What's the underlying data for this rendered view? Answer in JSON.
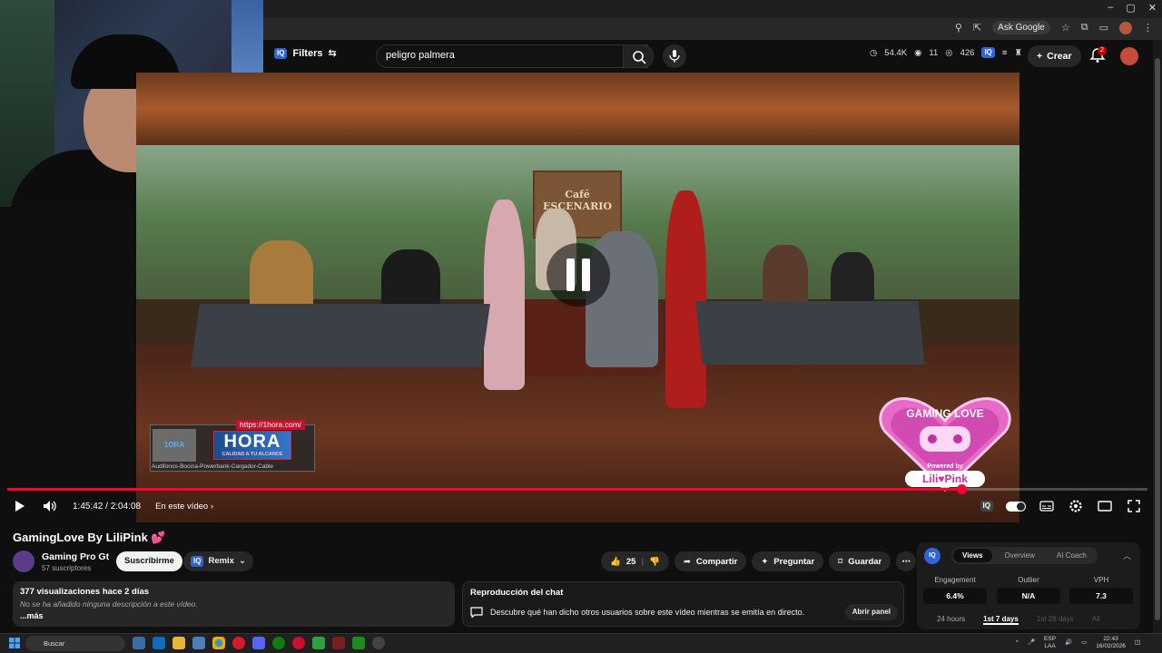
{
  "browser": {
    "ask_google": "Ask Google",
    "window_controls": [
      "–",
      "▢",
      "✕"
    ]
  },
  "header": {
    "filters_label": "Filters",
    "iq_badge": "IQ",
    "search": {
      "value": "peligro palmera",
      "placeholder": "Buscar"
    },
    "stats": {
      "views": "54.4K",
      "watching": "11",
      "comments": "426"
    },
    "create_label": "Crear",
    "notifications_count": "2"
  },
  "video": {
    "sign_text": "Café ESCENARIO",
    "ad": {
      "url": "https://1hora.com/",
      "brand": "HORA",
      "tagline": "CALIDAD A TU ALCANCE",
      "mini_label": "1ORA",
      "subtitle": "Audifonos-Bocina-Powerbank-Cargador-Cable"
    },
    "logo": {
      "line1": "GAMING LOVE",
      "line2": "Powered by",
      "line3": "Lili♥Pink"
    },
    "progress_fraction": 0.8369,
    "time_current": "1:45:42",
    "time_total": "2:04:08",
    "chapter_label": "En este vídeo",
    "iq_ctrl": "IQ"
  },
  "info": {
    "title": "GamingLove By LiliPink 💕",
    "channel": "Gaming Pro Gt",
    "subscribers": "57 suscriptores",
    "subscribe_label": "Suscribirme",
    "remix_label": "Remix",
    "likes": "25",
    "share_label": "Compartir",
    "ask_label": "Preguntar",
    "save_label": "Guardar"
  },
  "description": {
    "views": "377 visualizaciones  hace 2 días",
    "text": "No se ha añadido ninguna descripción a este vídeo.",
    "more": "...más"
  },
  "chat_replay": {
    "title": "Reproducción del chat",
    "text": "Descubre qué han dicho otros usuarios sobre este vídeo mientras se emitía en directo.",
    "open_label": "Abrir panel"
  },
  "iq_panel": {
    "logo": "IQ",
    "tabs": [
      "Views",
      "Overview",
      "AI Coach"
    ],
    "active_tab": "Views",
    "metrics": [
      {
        "label": "Engagement",
        "value": "6.4%"
      },
      {
        "label": "Outlier",
        "value": "N/A"
      },
      {
        "label": "VPH",
        "value": "7.3"
      }
    ],
    "periods": [
      "24 hours",
      "1st 7 days",
      "1st 28 days",
      "All"
    ],
    "active_period": "1st 7 days"
  },
  "taskbar": {
    "search_label": "Buscar",
    "lang": "ESP",
    "lang_sub": "LAA",
    "time": "22:43",
    "date": "16/02/2026"
  },
  "colors": {
    "accent": "#ff0033",
    "iq_blue": "#2f65d8",
    "bg": "#0f0f0f"
  }
}
